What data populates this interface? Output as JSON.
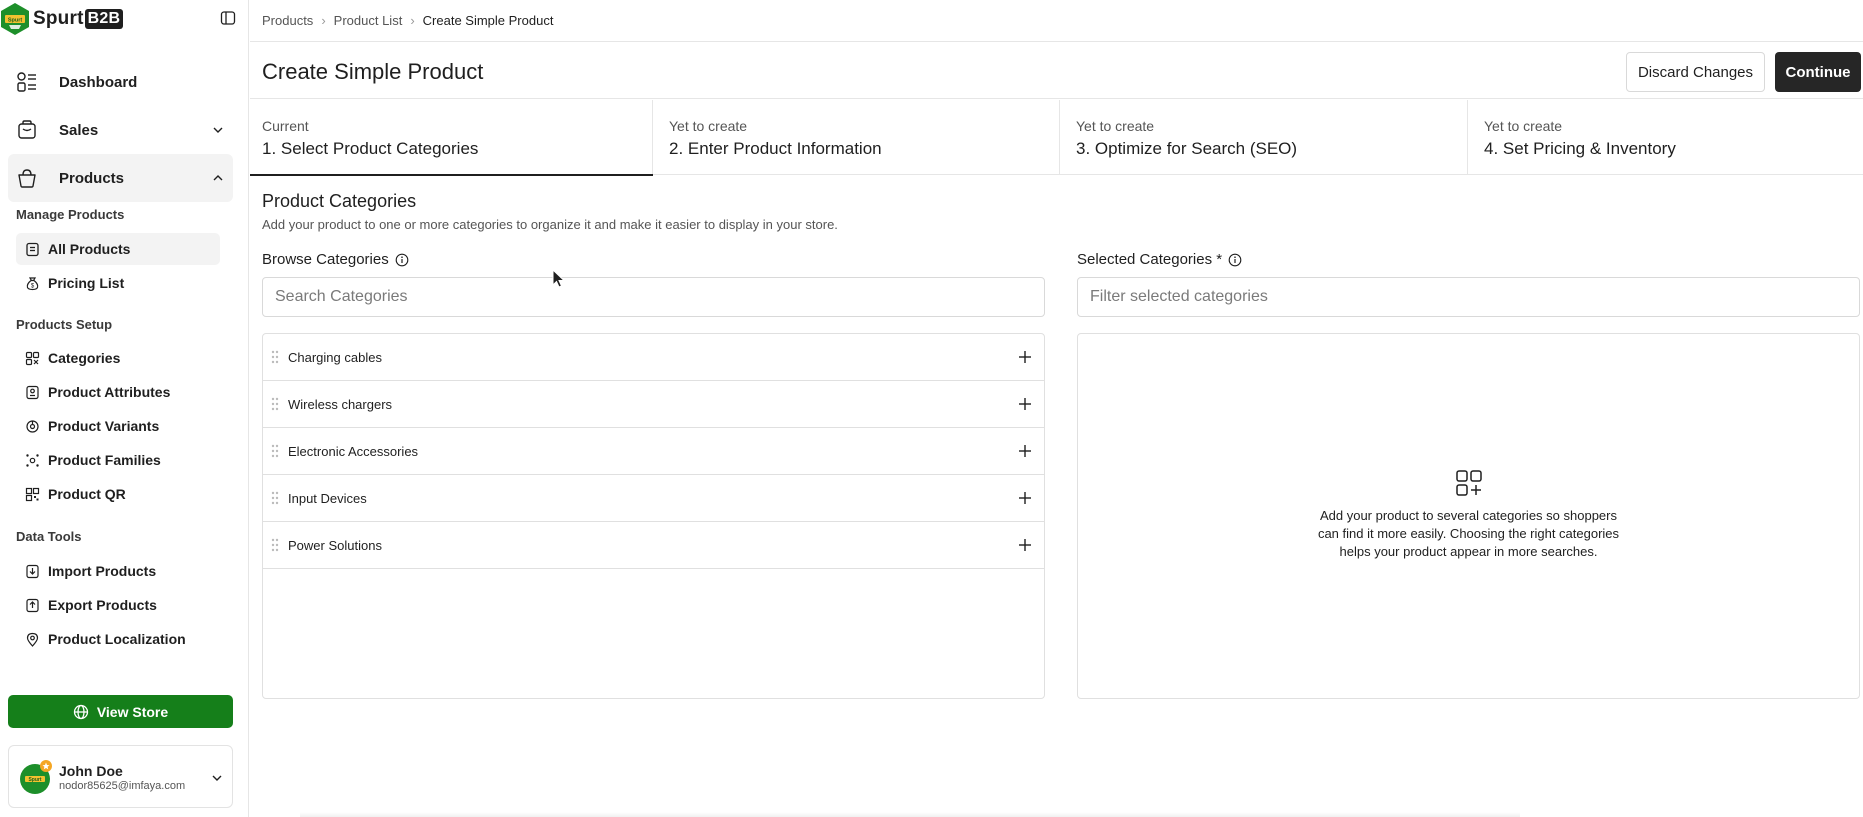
{
  "brand": {
    "name": "Spurt",
    "suffix": "B2B",
    "logo_text": "Spurt"
  },
  "sidebar": {
    "nav": [
      {
        "label": "Dashboard",
        "icon": "dashboard-icon"
      },
      {
        "label": "Sales",
        "icon": "shopping-bag-icon"
      },
      {
        "label": "Products",
        "icon": "basket-icon"
      }
    ],
    "sections": [
      {
        "title": "Manage Products",
        "items": [
          {
            "label": "All Products",
            "icon": "document-icon",
            "active": true
          },
          {
            "label": "Pricing List",
            "icon": "money-bag-icon"
          }
        ]
      },
      {
        "title": "Products Setup",
        "items": [
          {
            "label": "Categories",
            "icon": "categories-icon"
          },
          {
            "label": "Product Attributes",
            "icon": "attributes-icon"
          },
          {
            "label": "Product Variants",
            "icon": "variants-icon"
          },
          {
            "label": "Product Families",
            "icon": "families-icon"
          },
          {
            "label": "Product QR",
            "icon": "qr-code-icon"
          }
        ]
      },
      {
        "title": "Data Tools",
        "items": [
          {
            "label": "Import Products",
            "icon": "import-icon"
          },
          {
            "label": "Export Products",
            "icon": "export-icon"
          },
          {
            "label": "Product Localization",
            "icon": "location-pin-icon"
          }
        ]
      }
    ],
    "view_store": "View Store",
    "user": {
      "name": "John Doe",
      "email": "nodor85625@imfaya.com"
    }
  },
  "breadcrumb": [
    "Products",
    "Product List",
    "Create Simple Product"
  ],
  "header": {
    "title": "Create Simple Product",
    "discard_label": "Discard Changes",
    "continue_label": "Continue"
  },
  "steps": [
    {
      "status": "Current",
      "name": "1. Select Product Categories"
    },
    {
      "status": "Yet to create",
      "name": "2. Enter Product Information"
    },
    {
      "status": "Yet to create",
      "name": "3. Optimize for Search (SEO)"
    },
    {
      "status": "Yet to create",
      "name": "4. Set Pricing & Inventory"
    }
  ],
  "content": {
    "title": "Product Categories",
    "description": "Add your product to one or more categories to organize it and make it easier to display in your store.",
    "browse": {
      "label": "Browse Categories",
      "placeholder": "Search Categories",
      "categories": [
        "Charging cables",
        "Wireless chargers",
        "Electronic Accessories",
        "Input Devices",
        "Power Solutions"
      ]
    },
    "selected": {
      "label": "Selected Categories *",
      "placeholder": "Filter selected categories",
      "empty_text": "Add your product to several categories so shoppers can find it more easily. Choosing the right categories helps your product appear in more searches."
    }
  },
  "colors": {
    "accent_green": "#157f1a",
    "dark_button": "#262626",
    "border": "#e0e0e0",
    "badge_orange": "#f5a623"
  }
}
